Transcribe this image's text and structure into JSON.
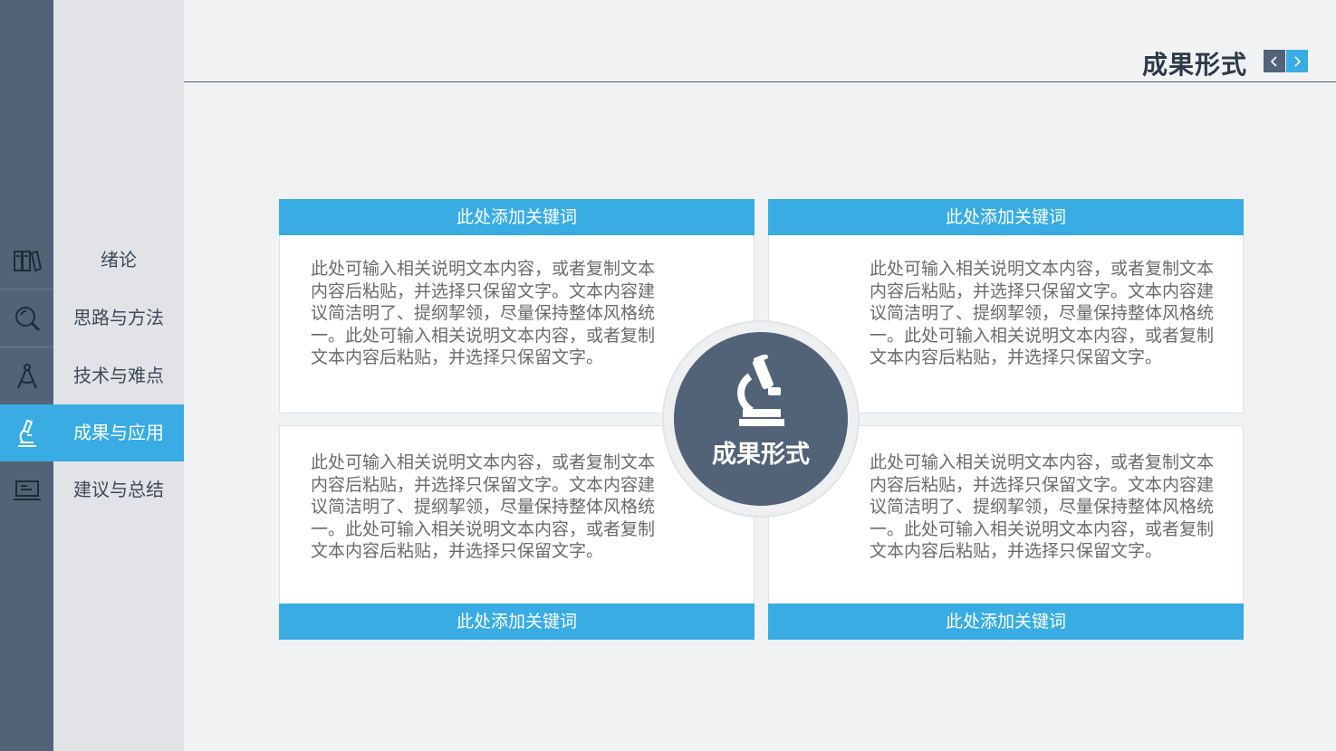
{
  "nav": {
    "items": [
      {
        "label": "绪论",
        "icon": "books-icon",
        "active": false
      },
      {
        "label": "思路与方法",
        "icon": "magnifier-icon",
        "active": false
      },
      {
        "label": "技术与难点",
        "icon": "compass-icon",
        "active": false
      },
      {
        "label": "成果与应用",
        "icon": "microscope-icon",
        "active": true
      },
      {
        "label": "建议与总结",
        "icon": "laptop-icon",
        "active": false
      }
    ]
  },
  "header": {
    "title": "成果形式",
    "prev_icon": "chevron-left-icon",
    "next_icon": "chevron-right-icon"
  },
  "center": {
    "label": "成果形式",
    "icon": "microscope-icon"
  },
  "cards": [
    {
      "keyword": "此处添加关键词",
      "body": "此处可输入相关说明文本内容，或者复制文本内容后粘贴，并选择只保留文字。文本内容建议简洁明了、提纲挈领，尽量保持整体风格统一。此处可输入相关说明文本内容，或者复制文本内容后粘贴，并选择只保留文字。"
    },
    {
      "keyword": "此处添加关键词",
      "body": "此处可输入相关说明文本内容，或者复制文本内容后粘贴，并选择只保留文字。文本内容建议简洁明了、提纲挈领，尽量保持整体风格统一。此处可输入相关说明文本内容，或者复制文本内容后粘贴，并选择只保留文字。"
    },
    {
      "keyword": "此处添加关键词",
      "body": "此处可输入相关说明文本内容，或者复制文本内容后粘贴，并选择只保留文字。文本内容建议简洁明了、提纲挈领，尽量保持整体风格统一。此处可输入相关说明文本内容，或者复制文本内容后粘贴，并选择只保留文字。"
    },
    {
      "keyword": "此处添加关键词",
      "body": "此处可输入相关说明文本内容，或者复制文本内容后粘贴，并选择只保留文字。文本内容建议简洁明了、提纲挈领，尽量保持整体风格统一。此处可输入相关说明文本内容，或者复制文本内容后粘贴，并选择只保留文字。"
    }
  ],
  "colors": {
    "accent": "#38ace3",
    "slate": "#526378",
    "sidebar": "#e2e3e6",
    "background": "#f1f2f4"
  }
}
